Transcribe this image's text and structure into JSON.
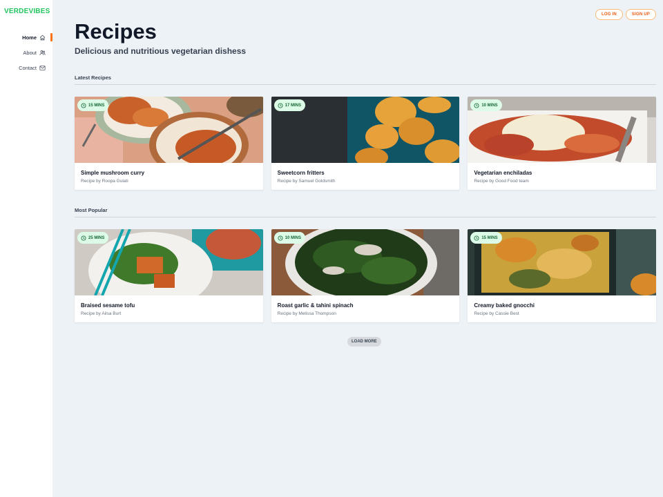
{
  "brand": "VERDEVIBES",
  "nav": [
    {
      "label": "Home",
      "icon": "home-icon",
      "active": true
    },
    {
      "label": "About",
      "icon": "users-icon",
      "active": false
    },
    {
      "label": "Contact",
      "icon": "mail-icon",
      "active": false
    }
  ],
  "auth": {
    "login": "LOG IN",
    "signup": "SIGN UP"
  },
  "page": {
    "title": "Recipes",
    "subtitle": "Delicious and nutritious vegetarian dishess"
  },
  "sections": [
    {
      "heading": "Latest Recipes",
      "cards": [
        {
          "time": "15 MINS",
          "title": "Simple mushroom curry",
          "author": "Recipe by Roopa Gulati"
        },
        {
          "time": "17 MINS",
          "title": "Sweetcorn fritters",
          "author": "Recipe by Samuel Goldsmith"
        },
        {
          "time": "10 MINS",
          "title": "Vegetarian enchiladas",
          "author": "Recipe by Good Food team"
        }
      ]
    },
    {
      "heading": "Most Popular",
      "cards": [
        {
          "time": "25 MINS",
          "title": "Braised sesame tofu",
          "author": "Recipe by Ailsa Burt"
        },
        {
          "time": "10 MINS",
          "title": "Roast garlic & tahini spinach",
          "author": "Recipe by Melissa Thompson"
        },
        {
          "time": "15 MINS",
          "title": "Creamy baked gnocchi",
          "author": "Recipe by Cassie Best"
        }
      ]
    }
  ],
  "load_more": "LOAD MORE",
  "colors": {
    "brand": "#22c55e",
    "accent": "#f97316",
    "badge_bg": "#dcfce7",
    "background": "#edf2f7"
  }
}
